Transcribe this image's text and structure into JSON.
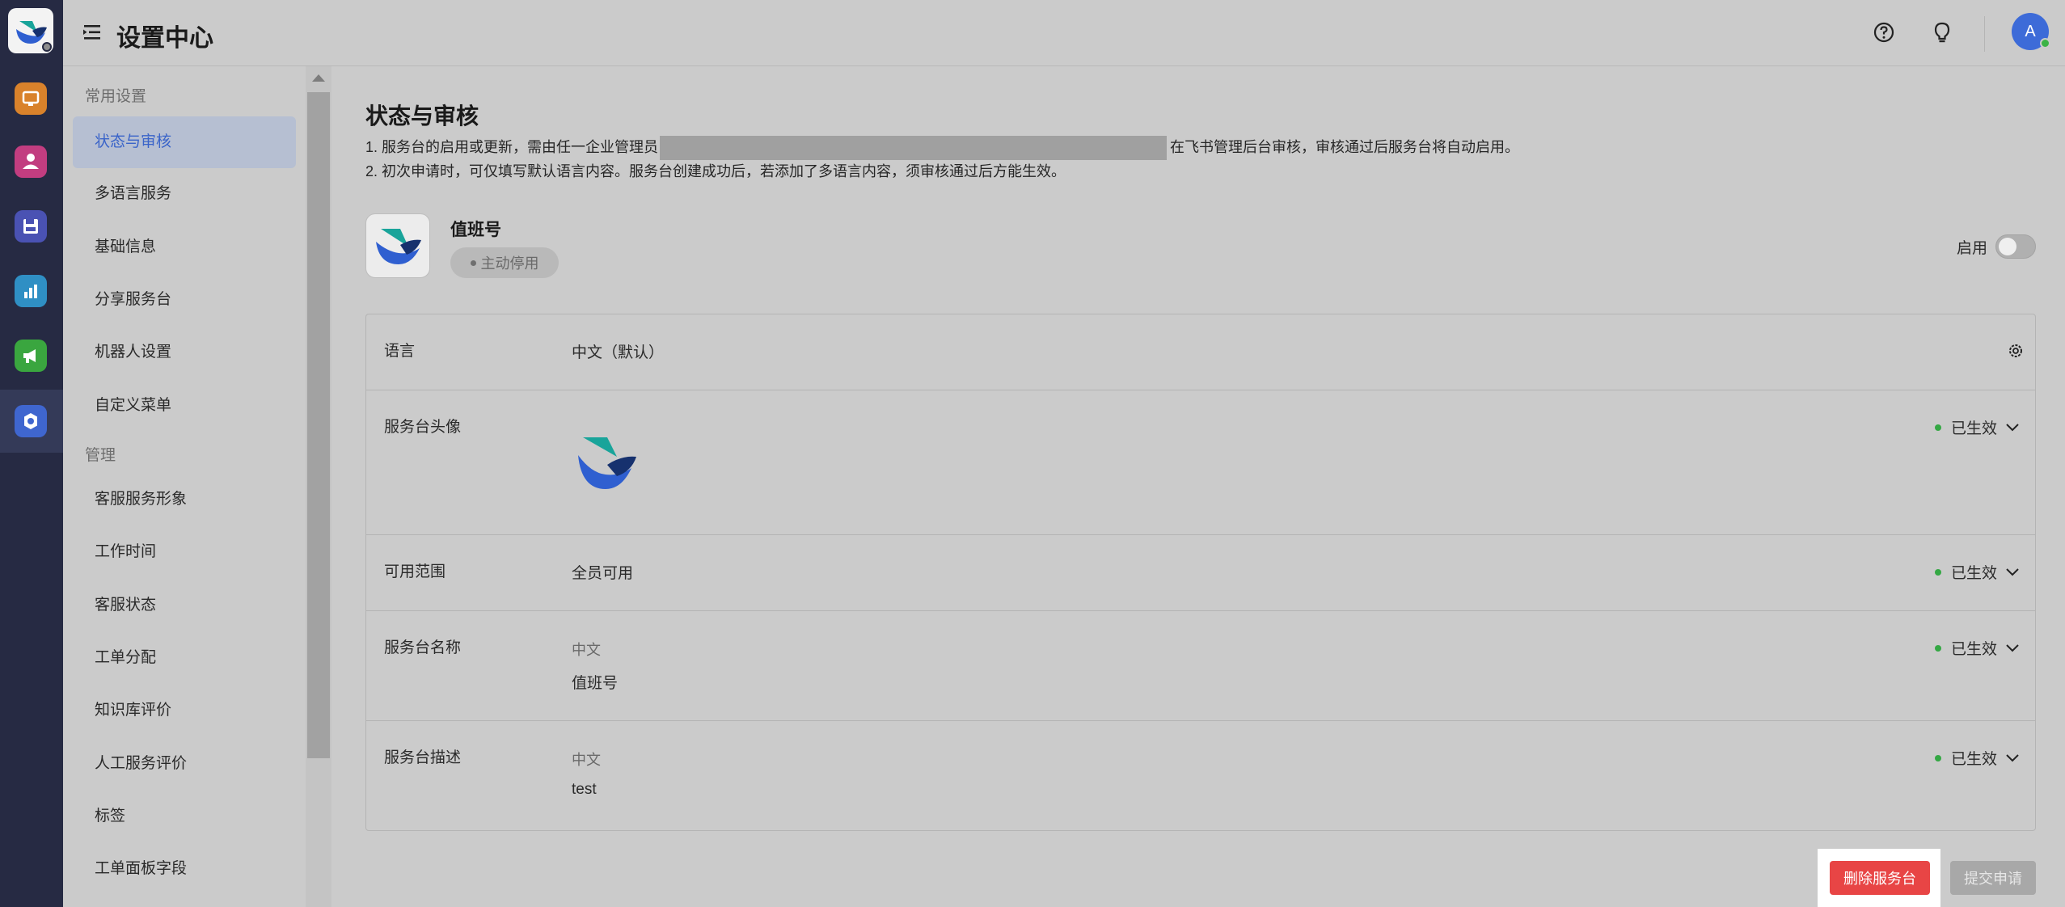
{
  "app": {
    "title": "设置中心",
    "avatar_initial": "A"
  },
  "rail": {
    "items": [
      {
        "icon": "monitor-icon",
        "color": "#d9822b"
      },
      {
        "icon": "user-icon",
        "color": "#c23d80"
      },
      {
        "icon": "save-icon",
        "color": "#4a52b3"
      },
      {
        "icon": "bar-chart-icon",
        "color": "#2f8fc4"
      },
      {
        "icon": "megaphone-icon",
        "color": "#3aa63f"
      },
      {
        "icon": "settings-icon",
        "color": "#3f66cf"
      }
    ]
  },
  "sidebar": {
    "group1": "常用设置",
    "group1_items": [
      {
        "label": "状态与审核"
      },
      {
        "label": "多语言服务"
      },
      {
        "label": "基础信息"
      },
      {
        "label": "分享服务台"
      },
      {
        "label": "机器人设置"
      },
      {
        "label": "自定义菜单"
      }
    ],
    "group2": "管理",
    "group2_items": [
      {
        "label": "客服服务形象"
      },
      {
        "label": "工作时间"
      },
      {
        "label": "客服状态"
      },
      {
        "label": "工单分配"
      },
      {
        "label": "知识库评价"
      },
      {
        "label": "人工服务评价"
      },
      {
        "label": "标签"
      },
      {
        "label": "工单面板字段"
      }
    ]
  },
  "main": {
    "title": "状态与审核",
    "note1_prefix": "1. 服务台的启用或更新，需由任一企业管理员",
    "note1_suffix": "在飞书管理后台审核，审核通过后服务台将自动启用。",
    "note2": "2. 初次申请时，可仅填写默认语言内容。服务台创建成功后，若添加了多语言内容，须审核通过后方能生效。",
    "app_name": "值班号",
    "status_badge": "主动停用",
    "enable_label": "启用",
    "rows": {
      "language": {
        "label": "语言",
        "value": "中文（默认）"
      },
      "avatar": {
        "label": "服务台头像",
        "status": "已生效"
      },
      "scope": {
        "label": "可用范围",
        "value": "全员可用",
        "status": "已生效"
      },
      "name": {
        "label": "服务台名称",
        "sub": "中文",
        "value": "值班号",
        "status": "已生效"
      },
      "desc": {
        "label": "服务台描述",
        "sub": "中文",
        "value": "test",
        "status": "已生效"
      }
    },
    "delete_button": "删除服务台",
    "submit_button": "提交申请"
  }
}
